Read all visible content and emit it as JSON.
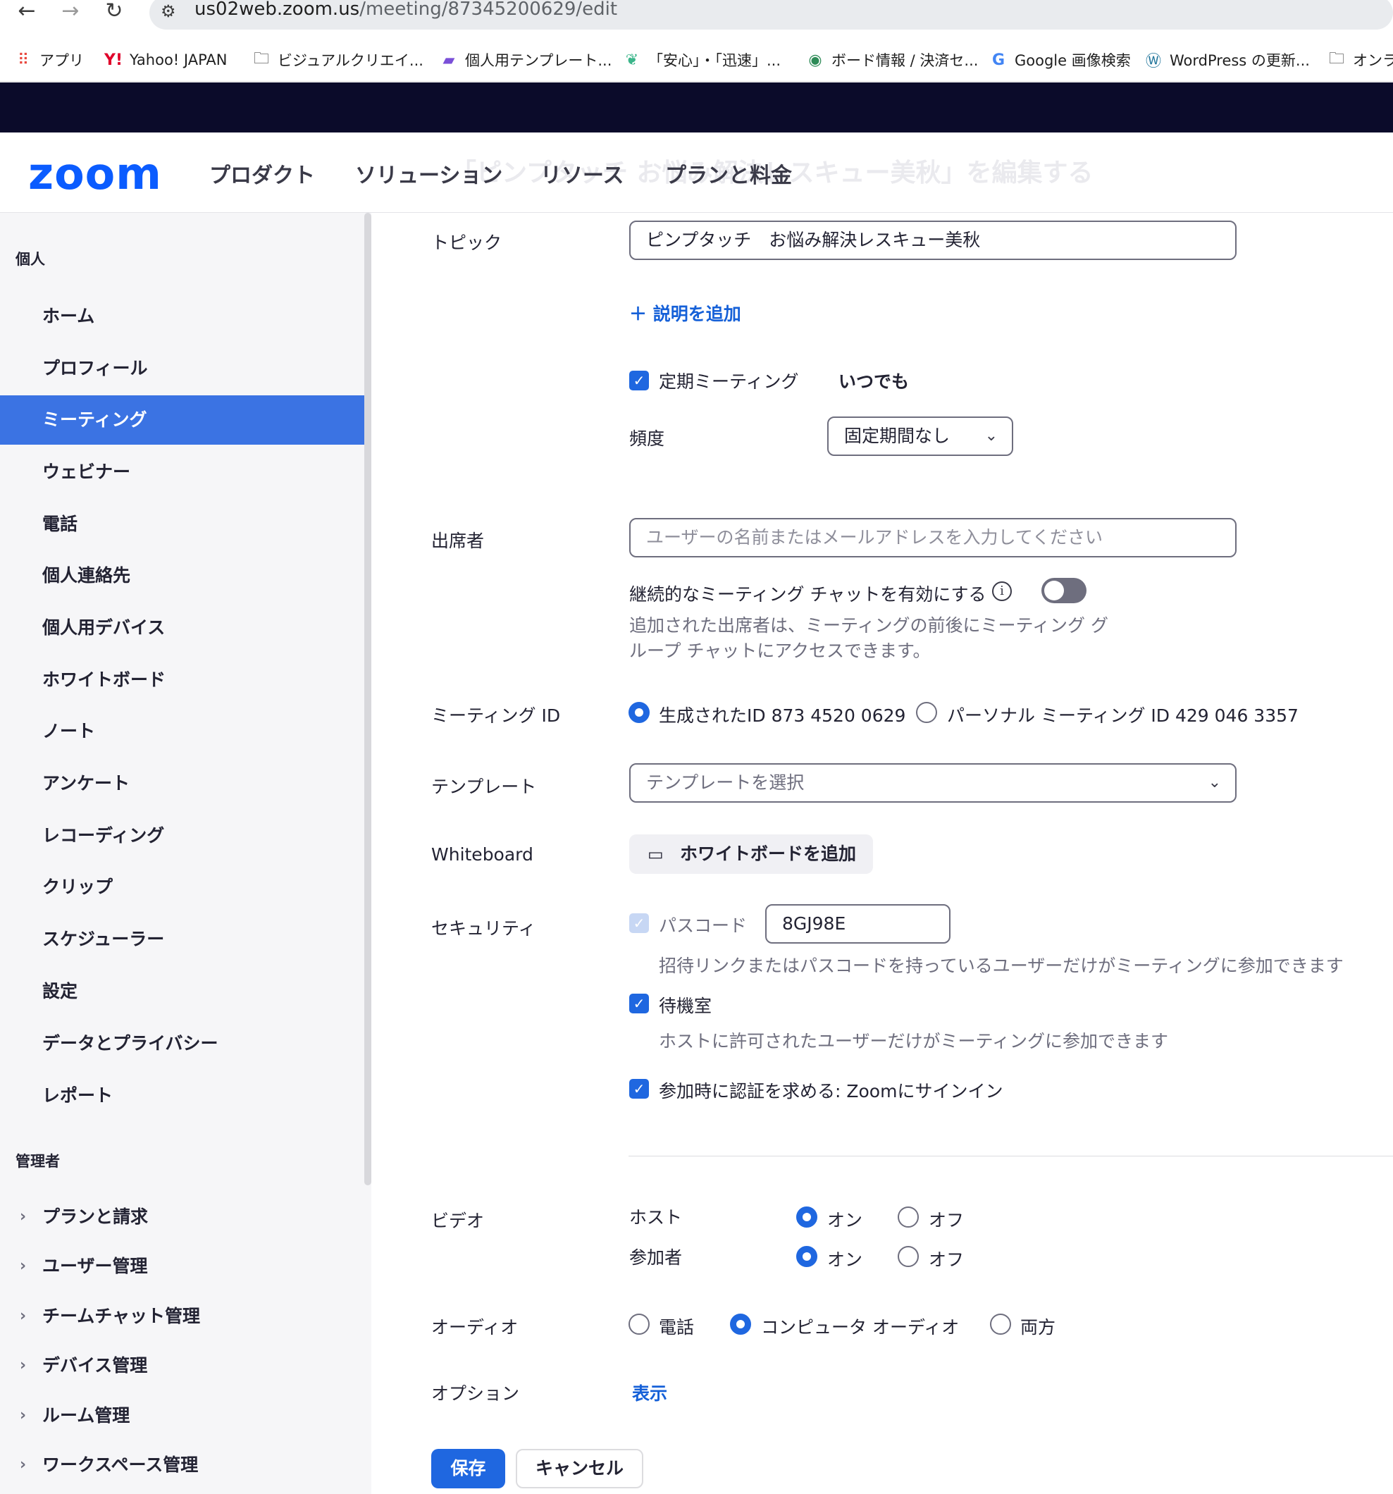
{
  "browser": {
    "back_icon": "←",
    "forward_icon": "→",
    "reload_icon": "↻",
    "url_host": "us02web.zoom.us",
    "url_path": "/meeting/87345200629/edit",
    "bookmarks": [
      {
        "icon": "apps-grid-icon",
        "label": "アプリ"
      },
      {
        "icon": "yahoo-icon",
        "label": "Yahoo! JAPAN"
      },
      {
        "icon": "folder-icon",
        "label": "ビジュアルクリエイ..."
      },
      {
        "icon": "template-icon",
        "label": "個人用テンプレート..."
      },
      {
        "icon": "leaf-icon",
        "label": "「安心」・「迅速」..."
      },
      {
        "icon": "globe-icon",
        "label": "ボード情報 / 決済セ..."
      },
      {
        "icon": "google-icon",
        "label": "Google 画像検索"
      },
      {
        "icon": "wordpress-icon",
        "label": "WordPress の更新..."
      },
      {
        "icon": "folder-icon",
        "label": "オンラ"
      }
    ]
  },
  "header": {
    "logo": "zoom",
    "ghost_title": "「ピンプタッチ お悩み解決レスキュー美秋」を編集する",
    "nav": [
      "プロダクト",
      "ソリューション",
      "リソース",
      "プランと料金"
    ]
  },
  "sidebar": {
    "personal_title": "個人",
    "personal_items": [
      "ホーム",
      "プロフィール",
      "ミーティング",
      "ウェビナー",
      "電話",
      "個人連絡先",
      "個人用デバイス",
      "ホワイトボード",
      "ノート",
      "アンケート",
      "レコーディング",
      "クリップ",
      "スケジューラー",
      "設定",
      "データとプライバシー",
      "レポート"
    ],
    "active_item": "ミーティング",
    "admin_title": "管理者",
    "admin_items": [
      "プランと請求",
      "ユーザー管理",
      "チームチャット管理",
      "デバイス管理",
      "ルーム管理",
      "ワークスペース管理"
    ]
  },
  "form": {
    "topic_label": "トピック",
    "topic_value": "ピンプタッチ　お悩み解決レスキュー美秋",
    "add_description": "説明を追加",
    "recurring_label": "定期ミーティング",
    "recurring_checked": true,
    "recurring_value": "いつでも",
    "frequency_label": "頻度",
    "frequency_value": "固定期間なし",
    "attendees_label": "出席者",
    "attendees_placeholder": "ユーザーの名前またはメールアドレスを入力してください",
    "chat_label": "継続的なミーティング チャットを有効にする",
    "chat_enabled": false,
    "chat_desc_line1": "追加された出席者は、ミーティングの前後にミーティング グ",
    "chat_desc_line2": "ループ チャットにアクセスできます。",
    "meeting_id_label": "ミーティング ID",
    "generated_id": "生成されたID 873 4520 0629",
    "personal_id": "パーソナル ミーティング ID 429 046 3357",
    "meeting_id_selected": "generated",
    "template_label": "テンプレート",
    "template_placeholder": "テンプレートを選択",
    "whiteboard_label": "Whiteboard",
    "whiteboard_button": "ホワイトボードを追加",
    "security_label": "セキュリティ",
    "passcode_label": "パスコード",
    "passcode_value": "8GJ98E",
    "passcode_desc": "招待リンクまたはパスコードを持っているユーザーだけがミーティングに参加できます",
    "waiting_room_label": "待機室",
    "waiting_room_desc": "ホストに許可されたユーザーだけがミーティングに参加できます",
    "auth_label": "参加時に認証を求める:  Zoomにサインイン",
    "video_label": "ビデオ",
    "host_label": "ホスト",
    "participant_label": "参加者",
    "on_label": "オン",
    "off_label": "オフ",
    "audio_label": "オーディオ",
    "audio_phone": "電話",
    "audio_computer": "コンピュータ オーディオ",
    "audio_both": "両方",
    "audio_selected": "computer",
    "options_label": "オプション",
    "options_link": "表示",
    "save_button": "保存",
    "cancel_button": "キャンセル"
  },
  "colors": {
    "brand": "#0b5cff",
    "accent": "#1f67e0",
    "sidebar_active": "#3b73e3",
    "dark_bar": "#0b0b2a"
  }
}
